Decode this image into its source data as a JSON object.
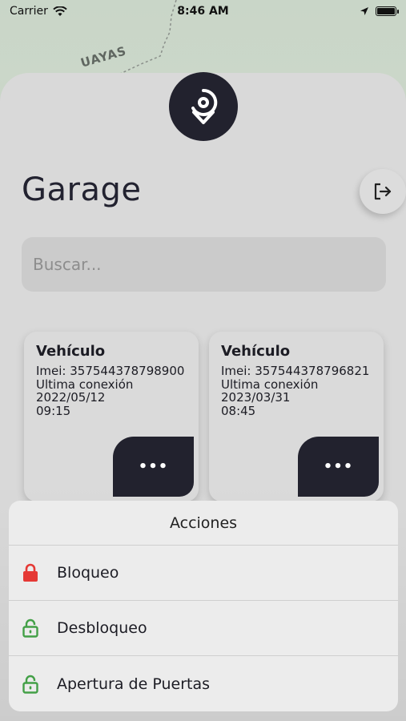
{
  "status_bar": {
    "carrier": "Carrier",
    "time": "8:46 AM"
  },
  "map": {
    "label": "UAYAS"
  },
  "header": {
    "title": "Garage"
  },
  "search": {
    "placeholder": "Buscar..."
  },
  "vehicles": [
    {
      "title": "Vehículo",
      "imei": "Imei: 357544378798900",
      "last_connection_label": "Ultima conexión",
      "date": "2022/05/12",
      "time": "09:15",
      "menu_label": "•••"
    },
    {
      "title": "Vehículo",
      "imei": "Imei: 357544378796821",
      "last_connection_label": "Ultima conexión",
      "date": "2023/03/31",
      "time": "08:45",
      "menu_label": "•••"
    }
  ],
  "actions": {
    "title": "Acciones",
    "items": [
      {
        "label": "Bloqueo",
        "icon": "lock-closed-icon",
        "color": "#e53935"
      },
      {
        "label": "Desbloqueo",
        "icon": "lock-open-icon",
        "color": "#43a047"
      },
      {
        "label": "Apertura de Puertas",
        "icon": "lock-open-icon",
        "color": "#43a047"
      }
    ]
  },
  "colors": {
    "primary_dark": "#22222e",
    "sheet_bg": "#d9d9d9"
  }
}
